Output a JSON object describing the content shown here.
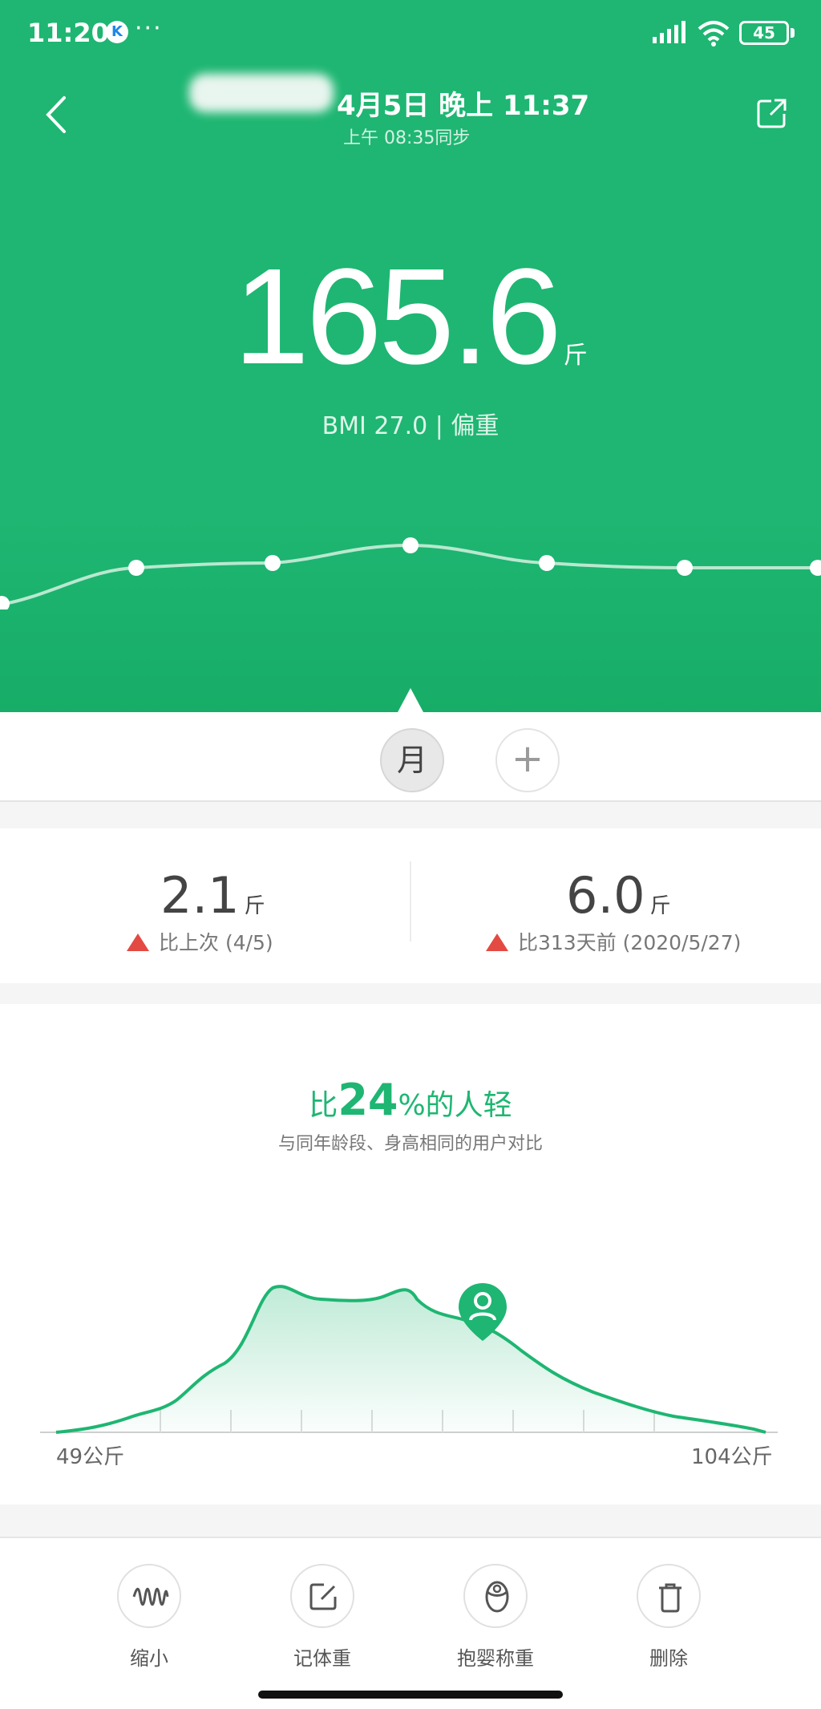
{
  "colors": {
    "accent": "#1eb672",
    "up_arrow": "#e34a42"
  },
  "status_bar": {
    "time": "11:20",
    "k_badge": "K",
    "dots": "···",
    "battery": "45"
  },
  "header": {
    "date_title": "4月5日 晚上 11:37",
    "sync_text": "上午 08:35同步"
  },
  "weight": {
    "value": "165.6",
    "unit": "斤",
    "bmi_text": "BMI 27.0 | 偏重"
  },
  "period": {
    "selected": "月",
    "add": "+"
  },
  "stats": [
    {
      "value": "2.1",
      "unit": "斤",
      "sub": "比上次 (4/5)"
    },
    {
      "value": "6.0",
      "unit": "斤",
      "sub": "比313天前 (2020/5/27)"
    }
  ],
  "comparison": {
    "prefix": "比",
    "percent": "24",
    "suffix": "%的人轻",
    "subtitle": "与同年龄段、身高相同的用户对比"
  },
  "distribution": {
    "min_label": "49公斤",
    "max_label": "104公斤"
  },
  "actions": [
    {
      "label": "缩小",
      "icon": "wave-icon"
    },
    {
      "label": "记体重",
      "icon": "edit-icon"
    },
    {
      "label": "抱婴称重",
      "icon": "baby-icon"
    },
    {
      "label": "删除",
      "icon": "trash-icon"
    }
  ]
}
